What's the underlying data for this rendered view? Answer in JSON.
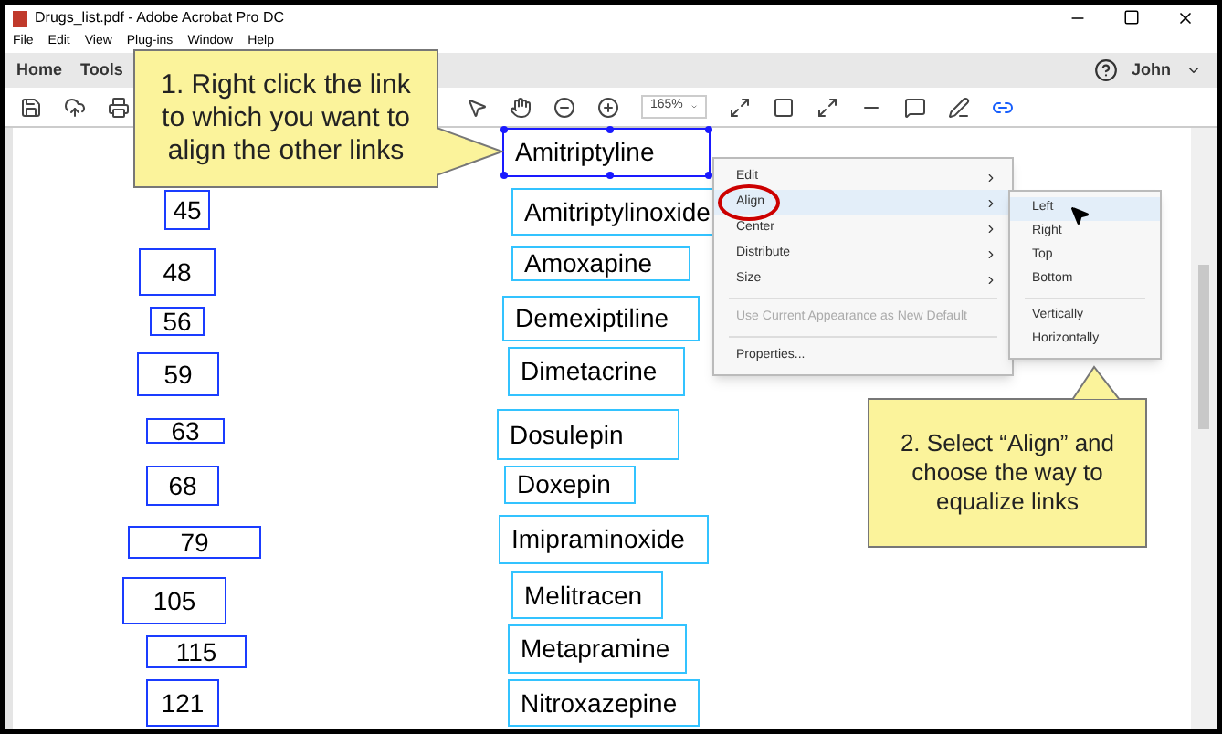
{
  "window": {
    "title": "Drugs_list.pdf - Adobe Acrobat Pro DC"
  },
  "menu_bar": [
    "File",
    "Edit",
    "View",
    "Plug-ins",
    "Window",
    "Help"
  ],
  "tabs": [
    {
      "label": "Home",
      "selected": false
    },
    {
      "label": "Tools",
      "selected": false
    }
  ],
  "user": "John",
  "zoom_value": "165%",
  "document": {
    "rows": [
      {
        "number": null,
        "name": "Amitriptyline",
        "selected": true
      },
      {
        "number": "45",
        "name": "Amitriptylinoxide",
        "selected": false
      },
      {
        "number": "48",
        "name": "Amoxapine",
        "selected": false
      },
      {
        "number": "56",
        "name": "Demexiptiline",
        "selected": false
      },
      {
        "number": "59",
        "name": "Dimetacrine",
        "selected": false
      },
      {
        "number": "63",
        "name": "Dosulepin",
        "selected": false
      },
      {
        "number": "68",
        "name": "Doxepin",
        "selected": false
      },
      {
        "number": "79",
        "name": "Imipraminoxide",
        "selected": false
      },
      {
        "number": "105",
        "name": "Melitracen",
        "selected": false
      },
      {
        "number": "115",
        "name": "Metapramine",
        "selected": false
      },
      {
        "number": "121",
        "name": "Nitroxazepine",
        "selected": false
      }
    ]
  },
  "context_menu": {
    "items": [
      {
        "kind": "submenu",
        "label": "Edit",
        "selected": false,
        "disabled": false
      },
      {
        "kind": "submenu",
        "label": "Align",
        "selected": true,
        "disabled": false
      },
      {
        "kind": "submenu",
        "label": "Center",
        "selected": false,
        "disabled": false
      },
      {
        "kind": "submenu",
        "label": "Distribute",
        "selected": false,
        "disabled": false
      },
      {
        "kind": "submenu",
        "label": "Size",
        "selected": false,
        "disabled": false
      },
      {
        "kind": "separator"
      },
      {
        "kind": "item",
        "label": "Use Current Appearance as New Default",
        "selected": false,
        "disabled": true
      },
      {
        "kind": "separator"
      },
      {
        "kind": "item",
        "label": "Properties...",
        "selected": false,
        "disabled": false
      }
    ]
  },
  "submenu": {
    "items": [
      {
        "kind": "item",
        "label": "Left",
        "selected": true
      },
      {
        "kind": "item",
        "label": "Right",
        "selected": false
      },
      {
        "kind": "item",
        "label": "Top",
        "selected": false
      },
      {
        "kind": "item",
        "label": "Bottom",
        "selected": false
      },
      {
        "kind": "separator"
      },
      {
        "kind": "item",
        "label": "Vertically",
        "selected": false
      },
      {
        "kind": "item",
        "label": "Horizontally",
        "selected": false
      }
    ]
  },
  "callouts": [
    "1. Right click the link to which you want to align the other links",
    "2. Select “Align” and choose the way to equalize links"
  ]
}
